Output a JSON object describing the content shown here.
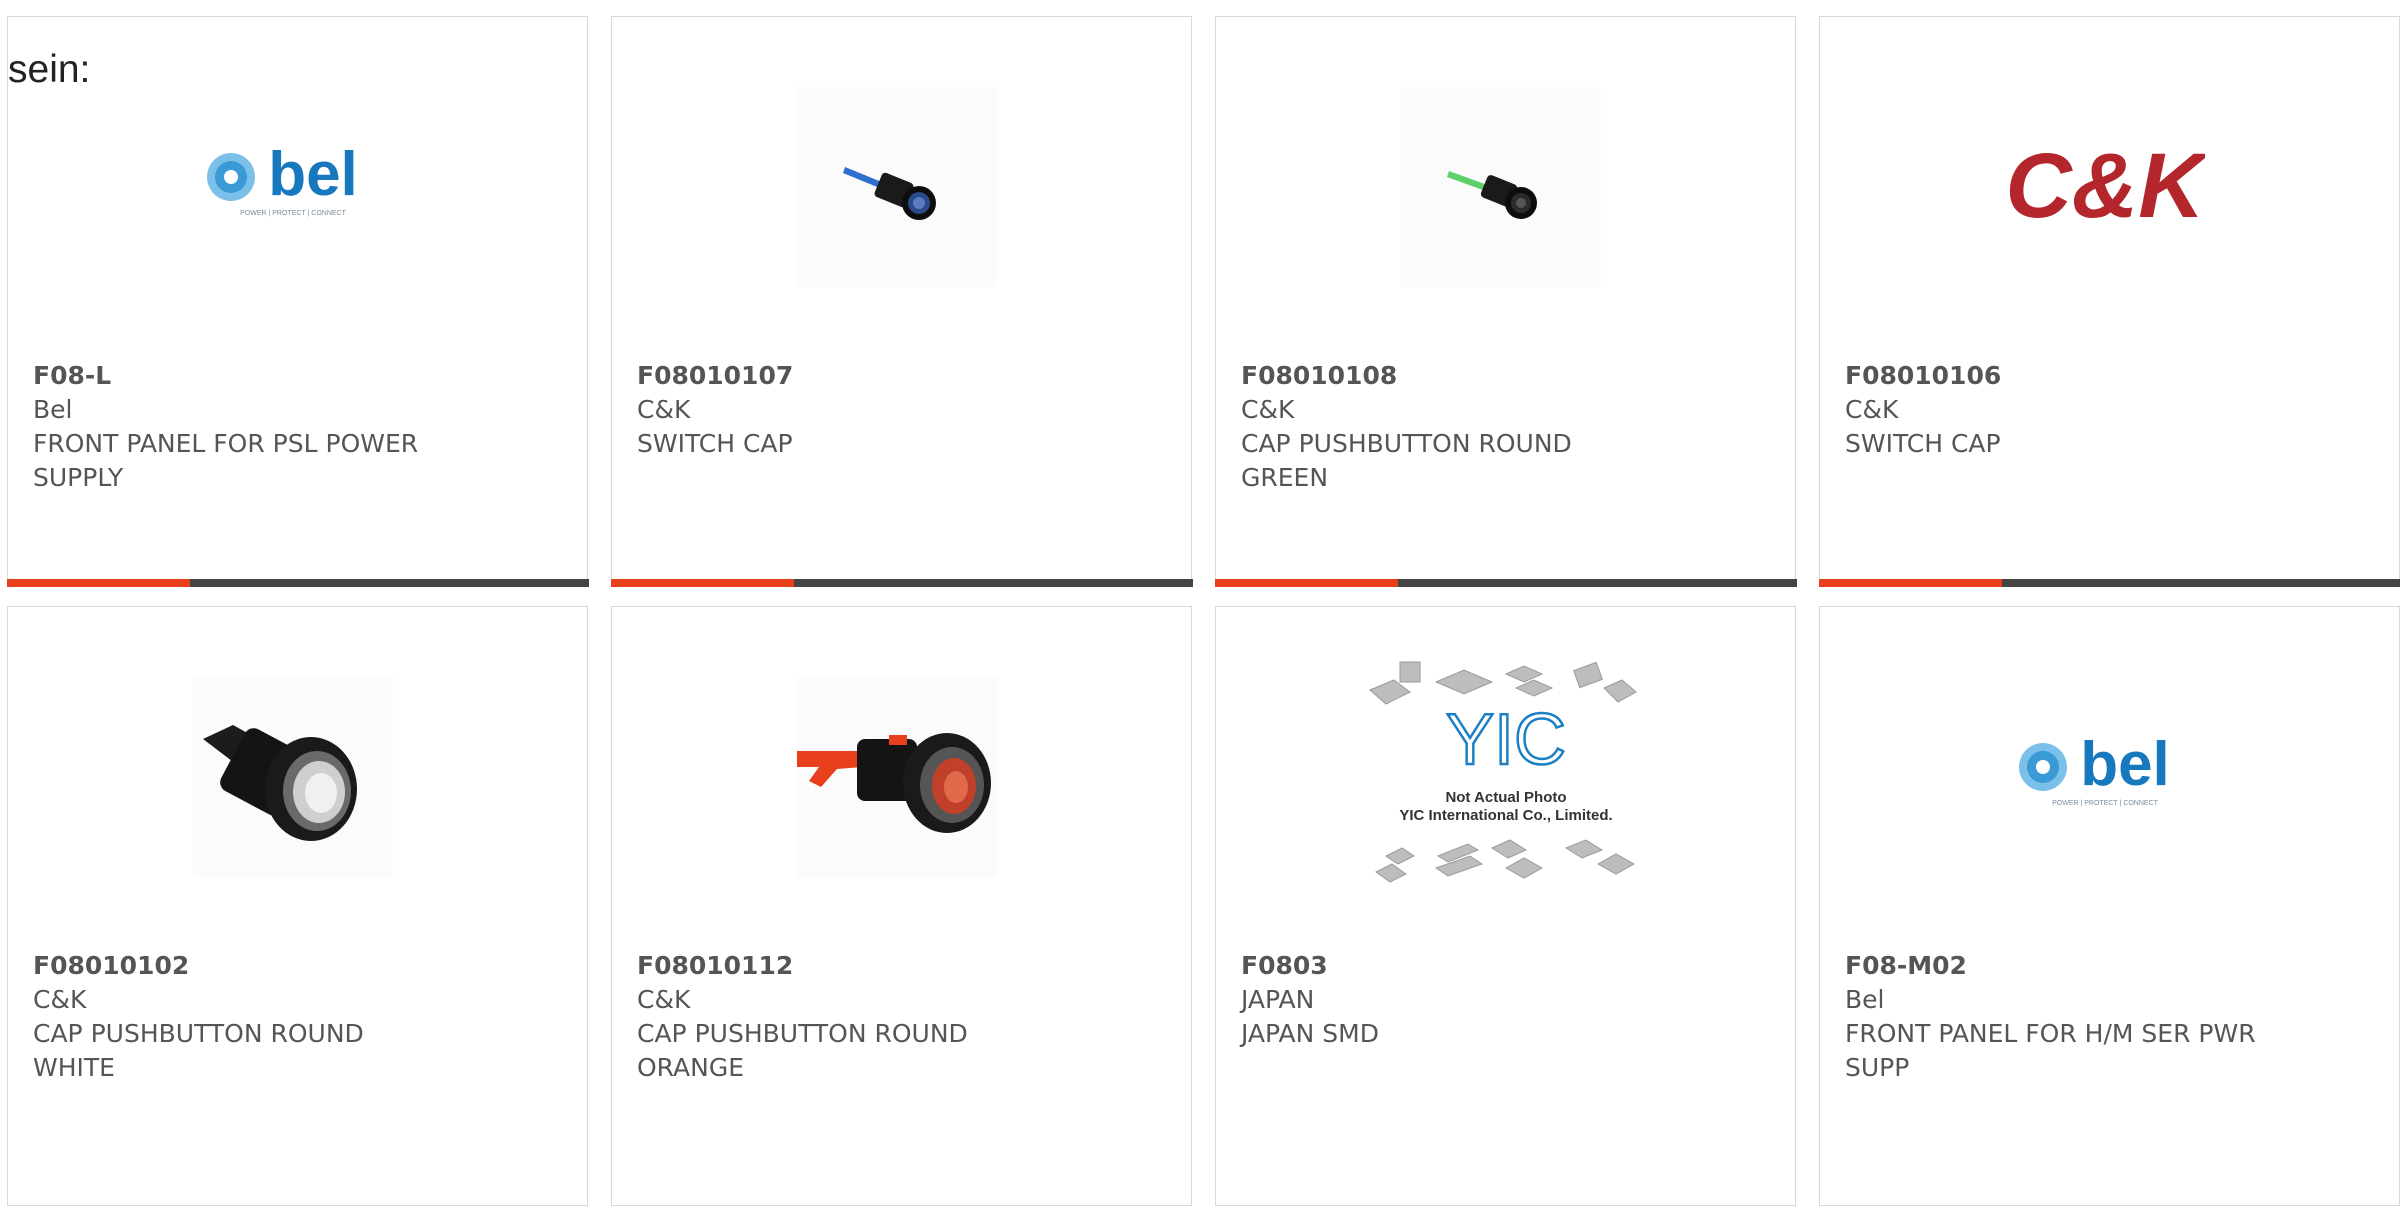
{
  "intro_text": "sein:",
  "colors": {
    "accent": "#e8401c",
    "bar": "#444444",
    "border": "#d9d9d9",
    "text": "#555555"
  },
  "products": [
    {
      "part_number": "F08-L",
      "manufacturer": "Bel",
      "description": "FRONT PANEL FOR PSL POWER SUPPLY",
      "image": "bel-logo",
      "logo_text": "bel",
      "logo_tagline": "POWER | PROTECT | CONNECT"
    },
    {
      "part_number": "F08010107",
      "manufacturer": "C&K",
      "description": "SWITCH CAP",
      "image": "switch-cap-blue"
    },
    {
      "part_number": "F08010108",
      "manufacturer": "C&K",
      "description": "CAP PUSHBUTTON ROUND GREEN",
      "image": "switch-cap-green"
    },
    {
      "part_number": "F08010106",
      "manufacturer": "C&K",
      "description": "SWITCH CAP",
      "image": "ck-logo",
      "logo_text": "C&K"
    },
    {
      "part_number": "F08010102",
      "manufacturer": "C&K",
      "description": "CAP PUSHBUTTON ROUND WHITE",
      "image": "pushbutton-white"
    },
    {
      "part_number": "F08010112",
      "manufacturer": "C&K",
      "description": "CAP PUSHBUTTON ROUND ORANGE",
      "image": "pushbutton-orange"
    },
    {
      "part_number": "F0803",
      "manufacturer": "JAPAN",
      "description": "JAPAN SMD",
      "image": "yic-placeholder",
      "logo_text": "YIC",
      "photo_note_1": "Not Actual Photo",
      "photo_note_2": "YIC International Co., Limited."
    },
    {
      "part_number": "F08-M02",
      "manufacturer": "Bel",
      "description": "FRONT PANEL FOR H/M SER PWR SUPP",
      "image": "bel-logo",
      "logo_text": "bel",
      "logo_tagline": "POWER | PROTECT | CONNECT"
    }
  ]
}
